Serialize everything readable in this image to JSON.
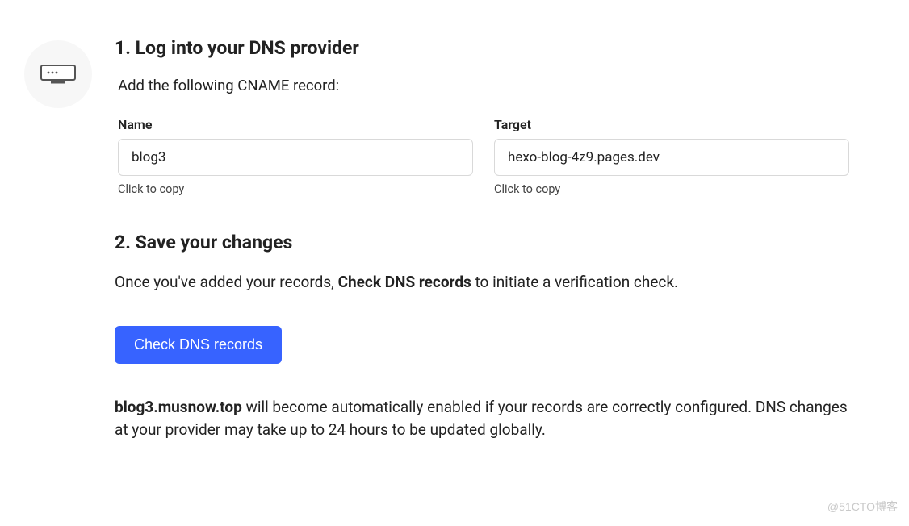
{
  "step1": {
    "title": "1. Log into your DNS provider",
    "instruction": "Add the following CNAME record:",
    "fields": {
      "name": {
        "label": "Name",
        "value": "blog3",
        "hint": "Click to copy"
      },
      "target": {
        "label": "Target",
        "value": "hexo-blog-4z9.pages.dev",
        "hint": "Click to copy"
      }
    }
  },
  "step2": {
    "title": "2. Save your changes",
    "instruction_pre": "Once you've added your records, ",
    "instruction_bold": "Check DNS records",
    "instruction_post": " to initiate a verification check.",
    "button": "Check DNS records",
    "note_bold": "blog3.musnow.top",
    "note_rest": " will become automatically enabled if your records are correctly configured. DNS changes at your provider may take up to 24 hours to be updated globally."
  },
  "watermark": "@51CTO博客"
}
